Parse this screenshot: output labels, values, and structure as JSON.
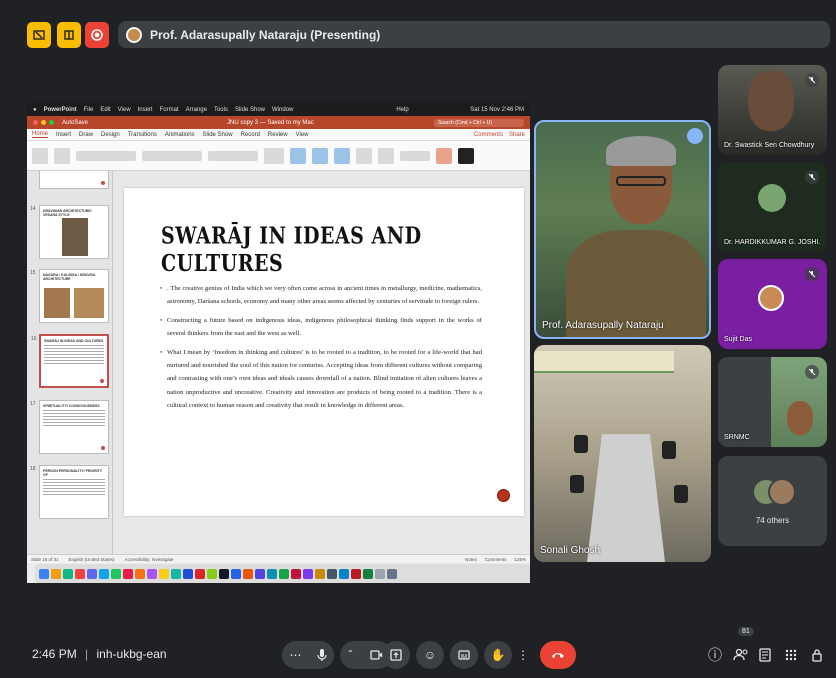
{
  "top_bar": {
    "presenter_title": "Prof. Adarasupally Nataraju (Presenting)",
    "colors": {
      "yellow": "#fbbc04",
      "red": "#ea4335"
    }
  },
  "presentation": {
    "mac_menu": [
      "PowerPoint",
      "File",
      "Edit",
      "View",
      "Insert",
      "Format",
      "Arrange",
      "Tools",
      "Slide Show",
      "Window",
      "Help"
    ],
    "mac_clock": "Sat 15 Nov 2:46 PM",
    "autosave": "AutoSave",
    "doc_title": "JNU copy 3 — Saved to my Mac",
    "search_placeholder": "Search (Cmd + Ctrl + U)",
    "ribbon_tabs": [
      "Home",
      "Insert",
      "Draw",
      "Design",
      "Transitions",
      "Animations",
      "Slide Show",
      "Record",
      "Review",
      "View"
    ],
    "comments": "Comments",
    "share": "Share",
    "thumbnails": [
      {
        "num": "",
        "title": ""
      },
      {
        "num": "14",
        "title": "DRAVIDIAN ARCHITECTURE/ VESARA STYLE"
      },
      {
        "num": "15",
        "title": "NAGARA / KALINGA / DRAVIDA ARCHITECTURE"
      },
      {
        "num": "16",
        "title": "SWARĀJ IN IDEAS AND CULTURES"
      },
      {
        "num": "17",
        "title": "SPIRITUALITY/ CONSCIOUSNESS"
      },
      {
        "num": "18",
        "title": "PERSON PERSONALITY/ PRIORITY OF"
      }
    ],
    "slide": {
      "title": "SWARĀJ IN IDEAS AND CULTURES",
      "bullets": [
        ". The creative genius of India which we very often come across in ancient times in metallurgy, medicine, mathematics, astronomy, Darśana schools, economy and many other areas seems affected by centuries of servitude to foreign rulers.",
        "Constructing a future based on indigenous ideas, indigenous philosophical thinking finds support in the works of several thinkers from the east and the west as well.",
        "What I mean by ‘freedom in thinking and cultures’ is to be rooted to a tradition, to be rooted for a life-world that had nurtured and nourished ‌the soul of this nation for centuries. Accepting ideas from different cultures without comparing and contrasting with one’s own ideas and ideals causes downfall of a nation. Blind imitation of alien cultures leaves a nation unproductive and uncreative. Creativity and innovation are products of being rooted to a tradition. There is a cultural context to human reason and creativity that result in knowledge in different areas."
      ]
    },
    "status": {
      "slide_counter": "Slide 16 of 31",
      "language": "English (United States)",
      "accessibility": "Accessibility: Investigate",
      "notes": "Notes",
      "comments": "Comments",
      "zoom": "125%"
    }
  },
  "participants": {
    "speaker": "Prof. Adarasupally Nataraju",
    "room": "Sonali Ghosh",
    "side": [
      {
        "name": "Dr. Swastick Sen Chowdhury"
      },
      {
        "name": "Dr. HARDIKKUMAR G. JOSHI."
      },
      {
        "name": "Sujit Das"
      },
      {
        "name": "SRNMC"
      }
    ],
    "others": "74 others"
  },
  "bottom_bar": {
    "time": "2:46 PM",
    "separator": "|",
    "meeting_code": "inh-ukbg-ean",
    "participant_count": "81"
  }
}
